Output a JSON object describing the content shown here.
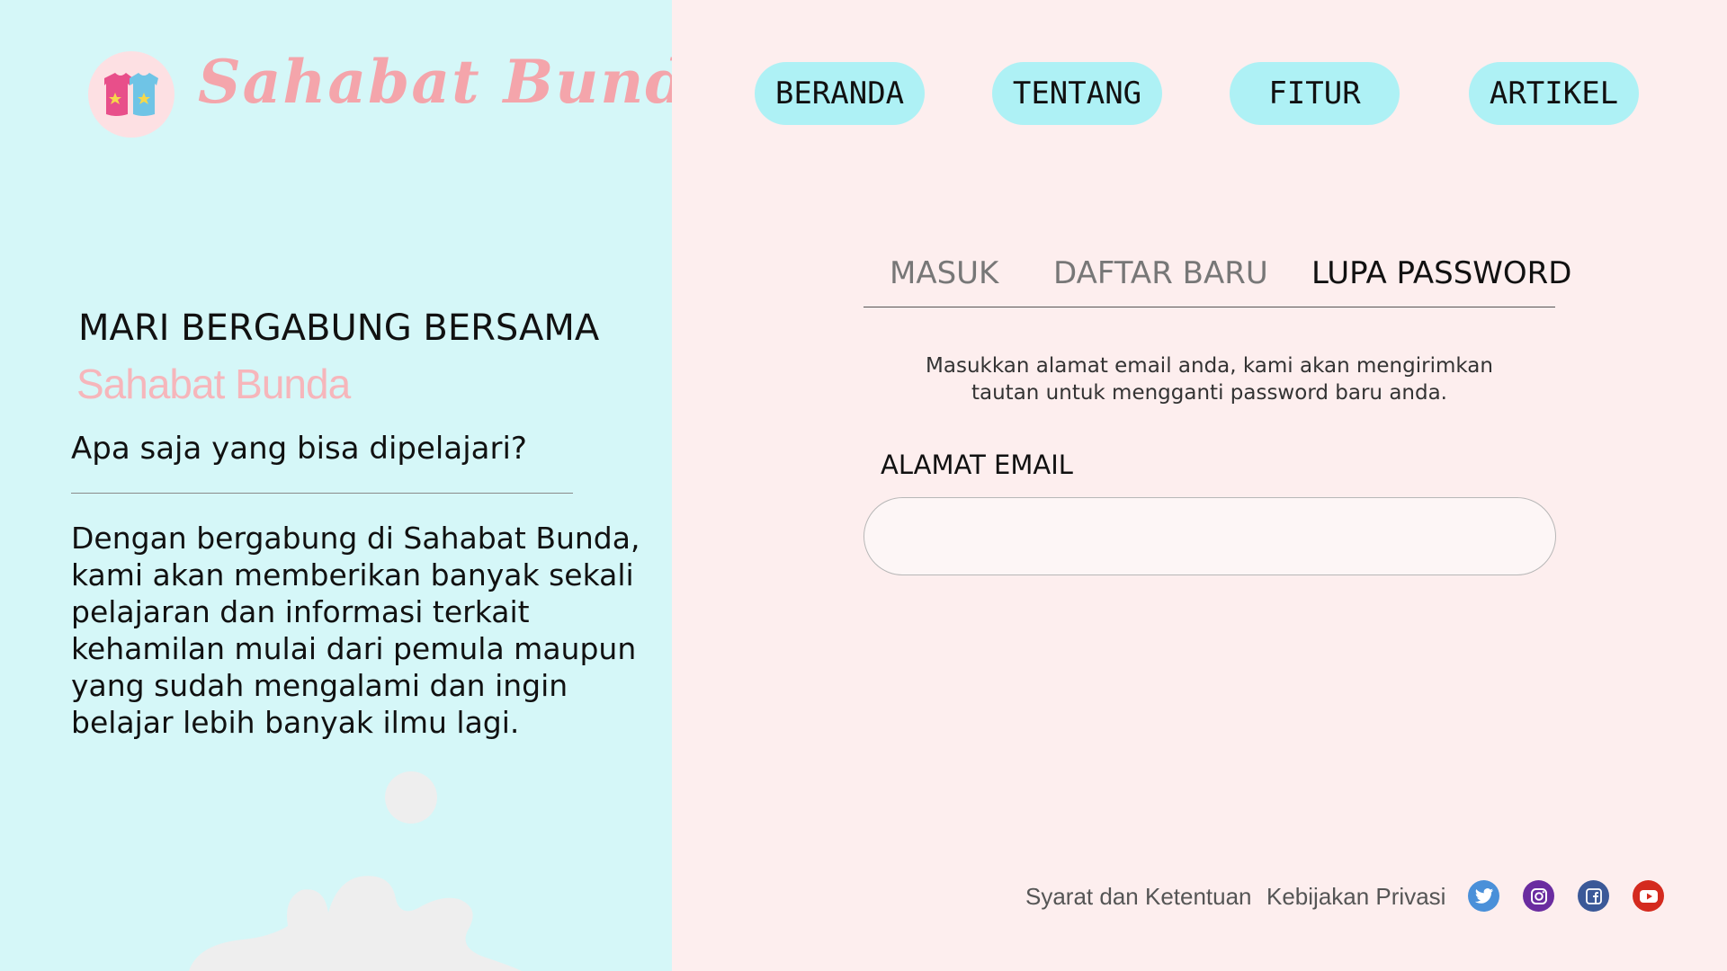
{
  "brand": {
    "name": "Sahabat Bunda"
  },
  "nav": {
    "items": [
      {
        "label": "BERANDA"
      },
      {
        "label": "TENTANG"
      },
      {
        "label": "FITUR"
      },
      {
        "label": "ARTIKEL"
      }
    ]
  },
  "left": {
    "title": "MARI BERGABUNG BERSAMA",
    "brand": "Sahabat Bunda",
    "question": "Apa saja yang bisa dipelajari?",
    "description": "Dengan bergabung di Sahabat Bunda, kami akan memberikan banyak sekali pelajaran dan informasi terkait kehamilan mulai dari pemula maupun yang sudah mengalami dan ingin belajar lebih banyak ilmu lagi."
  },
  "tabs": [
    {
      "label": "MASUK",
      "active": false
    },
    {
      "label": "DAFTAR BARU",
      "active": false
    },
    {
      "label": "LUPA PASSWORD",
      "active": true
    }
  ],
  "form": {
    "instruction_line1": "Masukkan alamat email anda, kami akan mengirimkan",
    "instruction_line2": "tautan untuk mengganti password baru anda.",
    "email_label": "ALAMAT EMAIL",
    "email_value": "",
    "email_placeholder": ""
  },
  "footer": {
    "links": [
      {
        "label": "Syarat dan Ketentuan"
      },
      {
        "label": "Kebijakan Privasi"
      }
    ],
    "social": [
      {
        "icon": "twitter-icon",
        "color": "#4a90d9"
      },
      {
        "icon": "instagram-icon",
        "color": "#6a2ca0"
      },
      {
        "icon": "facebook-icon",
        "color": "#3b5998"
      },
      {
        "icon": "youtube-icon",
        "color": "#d42a1e"
      }
    ]
  },
  "colors": {
    "left_bg": "#d5f7f8",
    "right_bg": "#fdeeee",
    "nav_button": "#aef1f5",
    "brand_pink": "#f4a5ab"
  }
}
